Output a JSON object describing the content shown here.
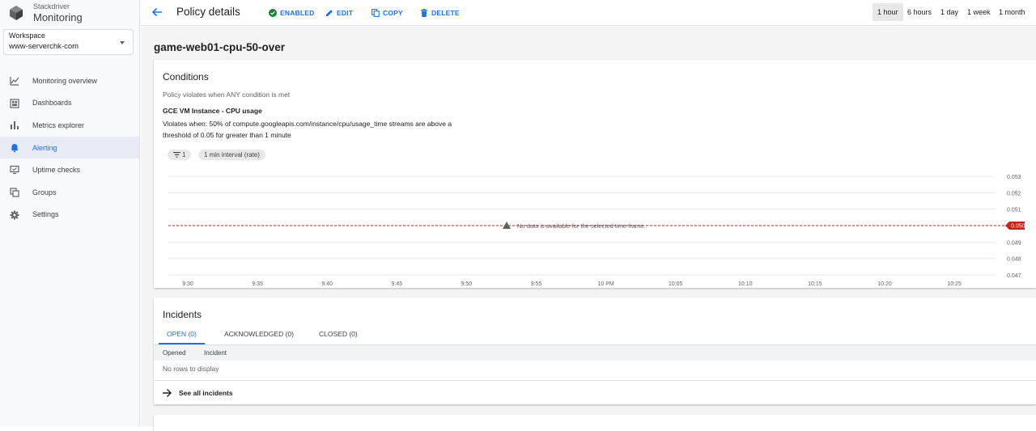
{
  "brand": {
    "subtitle": "Stackdriver",
    "title": "Monitoring"
  },
  "workspace": {
    "label": "Workspace",
    "value": "www-serverchk-com"
  },
  "sidebar": {
    "items": [
      {
        "label": "Monitoring overview",
        "icon": "monitoring-overview-icon"
      },
      {
        "label": "Dashboards",
        "icon": "dashboards-icon"
      },
      {
        "label": "Metrics explorer",
        "icon": "metrics-explorer-icon"
      },
      {
        "label": "Alerting",
        "icon": "bell-icon",
        "active": true
      },
      {
        "label": "Uptime checks",
        "icon": "uptime-checks-icon"
      },
      {
        "label": "Groups",
        "icon": "groups-icon"
      },
      {
        "label": "Settings",
        "icon": "gear-icon"
      }
    ]
  },
  "header": {
    "title": "Policy details",
    "actions": {
      "enabled": "ENABLED",
      "edit": "EDIT",
      "copy": "COPY",
      "delete": "DELETE"
    },
    "time_ranges": [
      "1 hour",
      "6 hours",
      "1 day",
      "1 week",
      "1 month"
    ],
    "selected_time_range": "1 hour"
  },
  "policy": {
    "name": "game-web01-cpu-50-over"
  },
  "conditions": {
    "title": "Conditions",
    "subtitle": "Policy violates when ANY condition is met",
    "condition_name": "GCE VM Instance - CPU usage",
    "description": "Violates when: 50% of compute.googleapis.com/instance/cpu/usage_time streams are above a threshold of 0.05 for greater than 1 minute",
    "chips": [
      "1",
      "1 min interval (rate)"
    ],
    "chart": {
      "x_ticks": [
        "9:30",
        "9:35",
        "9:40",
        "9:45",
        "9:50",
        "9:55",
        "10 PM",
        "10:05",
        "10:10",
        "10:15",
        "10:20",
        "10:25"
      ],
      "y_ticks": [
        "0.053",
        "0.052",
        "0.051",
        "0.050",
        "0.049",
        "0.048",
        "0.047"
      ],
      "threshold": "0.050",
      "no_data_message": "No data is available for the selected time frame."
    }
  },
  "incidents": {
    "title": "Incidents",
    "tabs": [
      "OPEN (0)",
      "ACKNOWLEDGED (0)",
      "CLOSED (0)"
    ],
    "columns": [
      "Opened",
      "Incident"
    ],
    "empty_text": "No rows to display",
    "see_all": "See all incidents"
  },
  "colors": {
    "accent": "#1a73e8",
    "threshold": "#c5221f",
    "enabled": "#188038"
  }
}
